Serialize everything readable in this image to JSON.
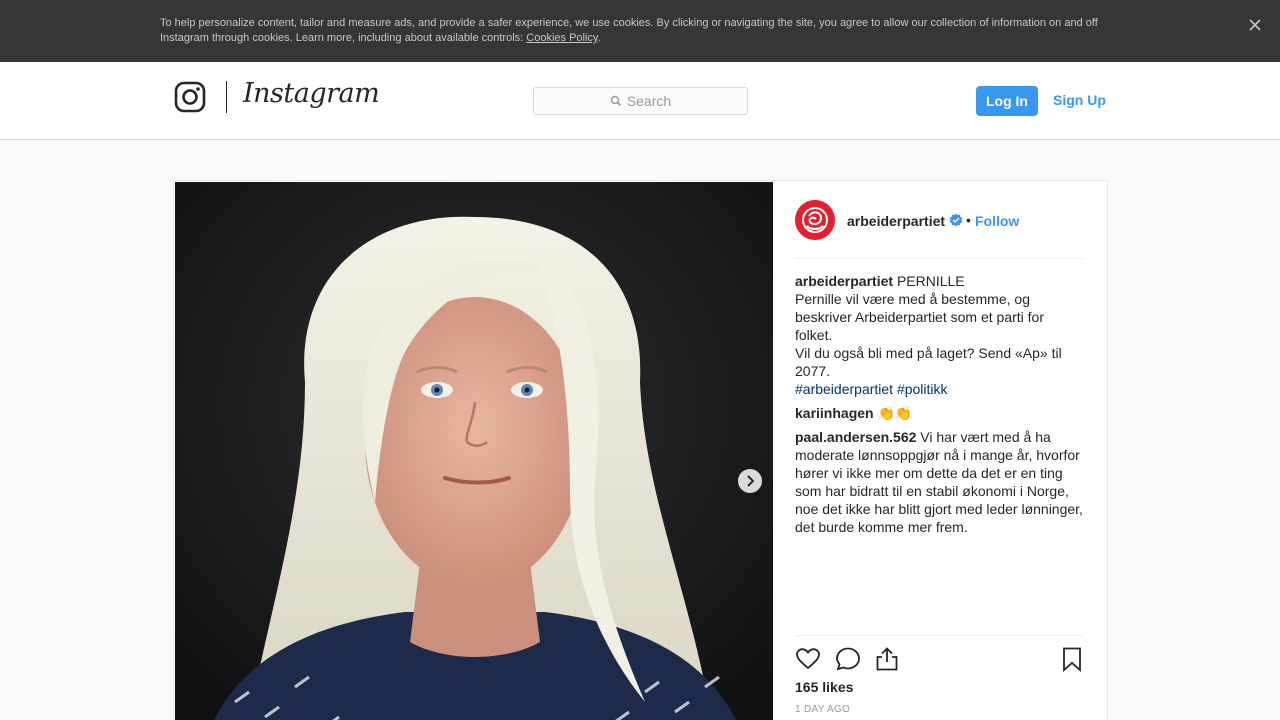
{
  "cookie_banner": {
    "text": "To help personalize content, tailor and measure ads, and provide a safer experience, we use cookies. By clicking or navigating the site, you agree to allow our collection of information on and off Instagram through cookies. Learn more, including about available controls: ",
    "link_label": "Cookies Policy",
    "after_link": ".",
    "close_icon": "close-icon"
  },
  "header": {
    "brand": "Instagram",
    "search_placeholder": "Search",
    "login_label": "Log In",
    "signup_label": "Sign Up"
  },
  "post": {
    "author": "arbeiderpartiet",
    "dot": "•",
    "follow_label": "Follow",
    "caption_first": "PERNILLE",
    "caption_lines": [
      "Pernille vil være med å bestemme, og beskriver Arbeiderpartiet som et parti for folket.",
      "Vil du også bli med på laget? Send «Ap» til 2077."
    ],
    "hashtags": [
      "#arbeiderpartiet",
      "#politikk"
    ],
    "comments": [
      {
        "user": "kariinhagen",
        "text": "👏👏"
      },
      {
        "user": "paal.andersen.562",
        "text": "Vi har vært med å ha moderate lønnsoppgjør nå i mange år, hvorfor hører vi ikke mer om dette da det er en ting som har bidratt til en stabil økonomi i Norge, noe det ikke har blitt gjort med leder lønninger, det burde komme mer frem."
      }
    ],
    "likes": "165 likes",
    "time": "1 DAY AGO"
  },
  "colors": {
    "accent": "#3897f0",
    "hashtag": "#003569",
    "banner": "#363636",
    "brand_red": "#e4202f"
  }
}
